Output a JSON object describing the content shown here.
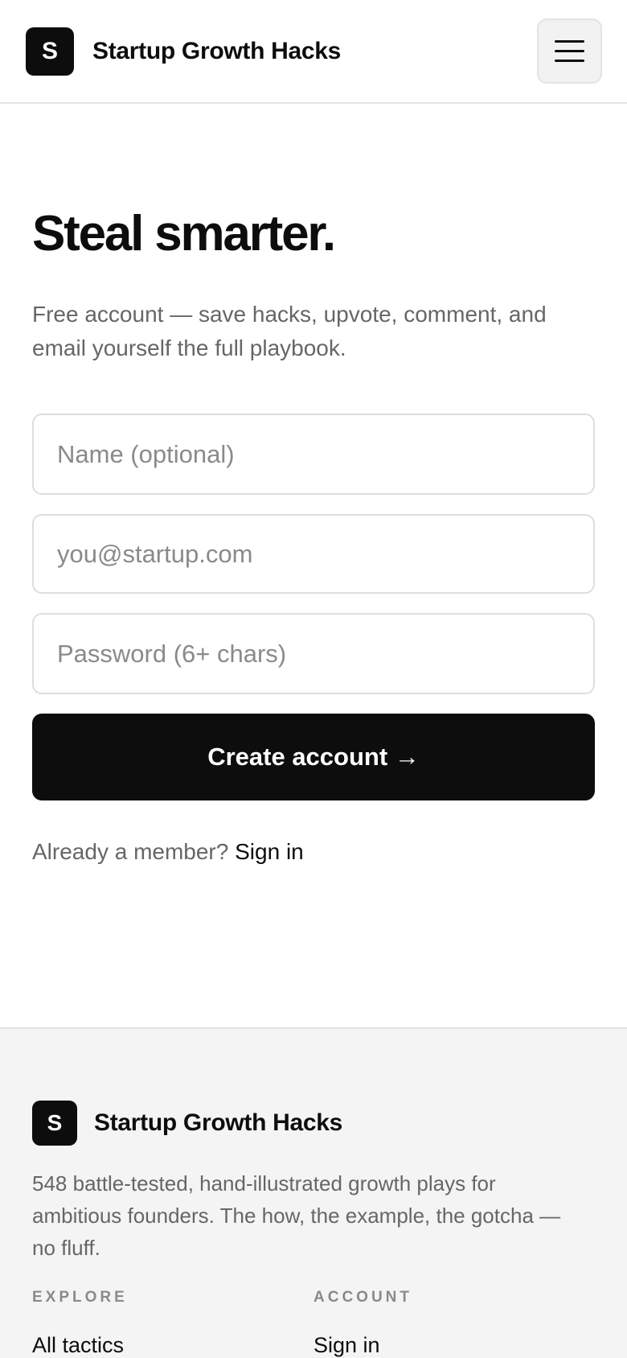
{
  "header": {
    "logo_letter": "S",
    "brand": "Startup Growth Hacks",
    "menu_icon": "hamburger-menu-icon"
  },
  "hero": {
    "title": "Steal smarter.",
    "subtitle": "Free account — save hacks, upvote, comment, and email yourself the full playbook."
  },
  "form": {
    "name_placeholder": "Name (optional)",
    "email_placeholder": "you@startup.com",
    "password_placeholder": "Password (6+ chars)",
    "submit_label": "Create account →"
  },
  "signin": {
    "prompt": "Already a member?",
    "link_label": "Sign in"
  },
  "footer": {
    "logo_letter": "S",
    "brand": "Startup Growth Hacks",
    "description": "548 battle-tested, hand-illustrated growth plays for ambitious founders. The how, the example, the gotcha — no fluff.",
    "columns": [
      {
        "heading": "EXPLORE",
        "links": [
          "All tactics"
        ]
      },
      {
        "heading": "ACCOUNT",
        "links": [
          "Sign in"
        ]
      }
    ]
  },
  "colors": {
    "primary": "#0d0d0d",
    "muted_text": "#666666",
    "footer_bg": "#f4f4f4"
  }
}
